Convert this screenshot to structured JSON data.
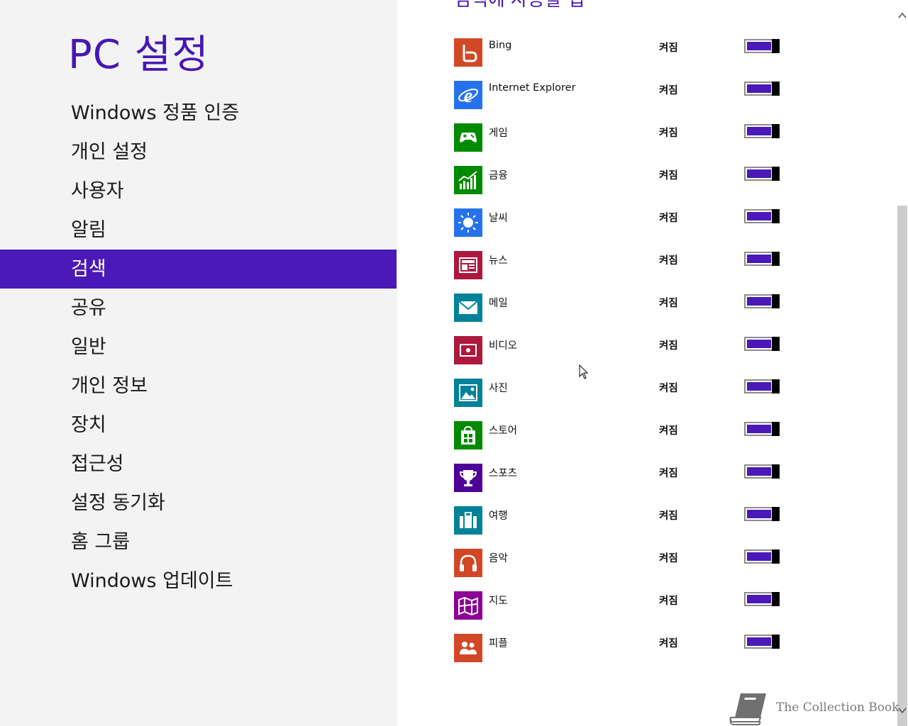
{
  "sidebar": {
    "title": "PC 설정",
    "items": [
      {
        "label": "Windows 정품 인증",
        "name": "nav-windows-activation",
        "selected": false
      },
      {
        "label": "개인 설정",
        "name": "nav-personalize",
        "selected": false
      },
      {
        "label": "사용자",
        "name": "nav-users",
        "selected": false
      },
      {
        "label": "알림",
        "name": "nav-notifications",
        "selected": false
      },
      {
        "label": "검색",
        "name": "nav-search",
        "selected": true
      },
      {
        "label": "공유",
        "name": "nav-share",
        "selected": false
      },
      {
        "label": "일반",
        "name": "nav-general",
        "selected": false
      },
      {
        "label": "개인 정보",
        "name": "nav-privacy",
        "selected": false
      },
      {
        "label": "장치",
        "name": "nav-devices",
        "selected": false
      },
      {
        "label": "접근성",
        "name": "nav-ease-of-access",
        "selected": false
      },
      {
        "label": "설정 동기화",
        "name": "nav-sync-settings",
        "selected": false
      },
      {
        "label": "홈 그룹",
        "name": "nav-homegroup",
        "selected": false
      },
      {
        "label": "Windows 업데이트",
        "name": "nav-windows-update",
        "selected": false
      }
    ]
  },
  "content": {
    "section_title": "검색에 사용할 앱",
    "apps": [
      {
        "name": "Bing",
        "state": "켜짐",
        "on": true,
        "icon": "bing-icon",
        "color": "#d24726"
      },
      {
        "name": "Internet Explorer",
        "state": "켜짐",
        "on": true,
        "icon": "internet-explorer-icon",
        "color": "#2672ec"
      },
      {
        "name": "게임",
        "state": "켜짐",
        "on": true,
        "icon": "games-controller-icon",
        "color": "#008a00"
      },
      {
        "name": "금융",
        "state": "켜짐",
        "on": true,
        "icon": "finance-chart-icon",
        "color": "#008a00"
      },
      {
        "name": "날씨",
        "state": "켜짐",
        "on": true,
        "icon": "weather-sun-icon",
        "color": "#2672ec"
      },
      {
        "name": "뉴스",
        "state": "켜짐",
        "on": true,
        "icon": "news-icon",
        "color": "#ac193d"
      },
      {
        "name": "메일",
        "state": "켜짐",
        "on": true,
        "icon": "mail-icon",
        "color": "#008299"
      },
      {
        "name": "비디오",
        "state": "켜짐",
        "on": true,
        "icon": "video-icon",
        "color": "#ac193d"
      },
      {
        "name": "사진",
        "state": "켜짐",
        "on": true,
        "icon": "photos-icon",
        "color": "#008299"
      },
      {
        "name": "스토어",
        "state": "켜짐",
        "on": true,
        "icon": "store-bag-icon",
        "color": "#008a00"
      },
      {
        "name": "스포츠",
        "state": "켜짐",
        "on": true,
        "icon": "sports-trophy-icon",
        "color": "#4e0097"
      },
      {
        "name": "여행",
        "state": "켜짐",
        "on": true,
        "icon": "travel-suitcase-icon",
        "color": "#008299"
      },
      {
        "name": "음악",
        "state": "켜짐",
        "on": true,
        "icon": "music-headphones-icon",
        "color": "#d24726"
      },
      {
        "name": "지도",
        "state": "켜짐",
        "on": true,
        "icon": "maps-icon",
        "color": "#8c0095"
      },
      {
        "name": "피플",
        "state": "켜짐",
        "on": true,
        "icon": "people-icon",
        "color": "#d24726"
      }
    ]
  },
  "colors": {
    "accent": "#4a19b8",
    "title": "#4617b4",
    "sidebar_bg": "#f3f3f3"
  },
  "watermark": {
    "text": "The Collection Book",
    "icon": "book-icon"
  },
  "icons": {
    "scroll_up": "chevron-up-icon",
    "scroll_down": "chevron-down-icon",
    "cursor": "mouse-cursor-icon"
  }
}
